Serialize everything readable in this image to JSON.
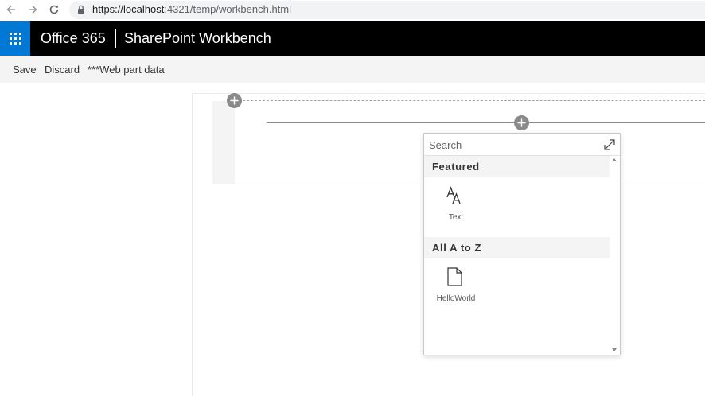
{
  "browser": {
    "url_scheme": "https://localhost",
    "url_port_path": ":4321/temp/workbench.html"
  },
  "suite": {
    "brand": "Office 365",
    "app_title": "SharePoint Workbench"
  },
  "commands": {
    "save": "Save",
    "discard": "Discard",
    "web_part_data": "***Web part data"
  },
  "toolbox": {
    "search_placeholder": "Search",
    "categories": [
      {
        "label": "Featured",
        "items": [
          {
            "label": "Text",
            "icon": "text-icon"
          }
        ]
      },
      {
        "label": "All A to Z",
        "items": [
          {
            "label": "HelloWorld",
            "icon": "document-icon"
          }
        ]
      }
    ]
  },
  "colors": {
    "suitebar": "#000000",
    "waffle": "#0078d4",
    "command_bar": "#f4f4f4"
  }
}
